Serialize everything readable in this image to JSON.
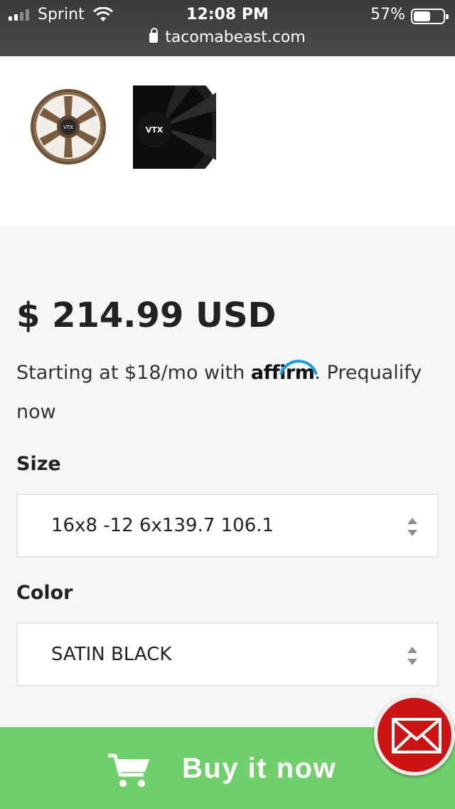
{
  "status_bar": {
    "carrier": "Sprint",
    "time": "12:08 PM",
    "battery_percent": "57%",
    "battery_level": 0.57,
    "signal_bars_filled": 2,
    "signal_bars_total": 4
  },
  "browser": {
    "url": "tacomabeast.com"
  },
  "thumbnails": [
    {
      "name": "bronze-wheel-thumbnail",
      "badge": "VTX"
    },
    {
      "name": "black-wheel-thumbnail",
      "badge": "VTX"
    }
  ],
  "product": {
    "price": "$ 214.99 USD",
    "affirm_prefix": "Starting at $18/mo with",
    "affirm_logo": "affirm",
    "affirm_suffix": ". Prequalify now",
    "size_label": "Size",
    "size_value": "16x8 -12 6x139.7 106.1",
    "color_label": "Color",
    "color_value": "SATIN BLACK"
  },
  "cta": {
    "buy_label": "Buy it now"
  },
  "colors": {
    "buy_bar": "#6fcf6a",
    "mail_bubble": "#cc1414",
    "affirm_arc": "#1a9ae0"
  },
  "icons": {
    "cart": "cart-icon",
    "mail": "mail-icon",
    "lock": "lock-icon",
    "wifi": "wifi-icon",
    "select_arrows": "updown-arrows-icon"
  }
}
